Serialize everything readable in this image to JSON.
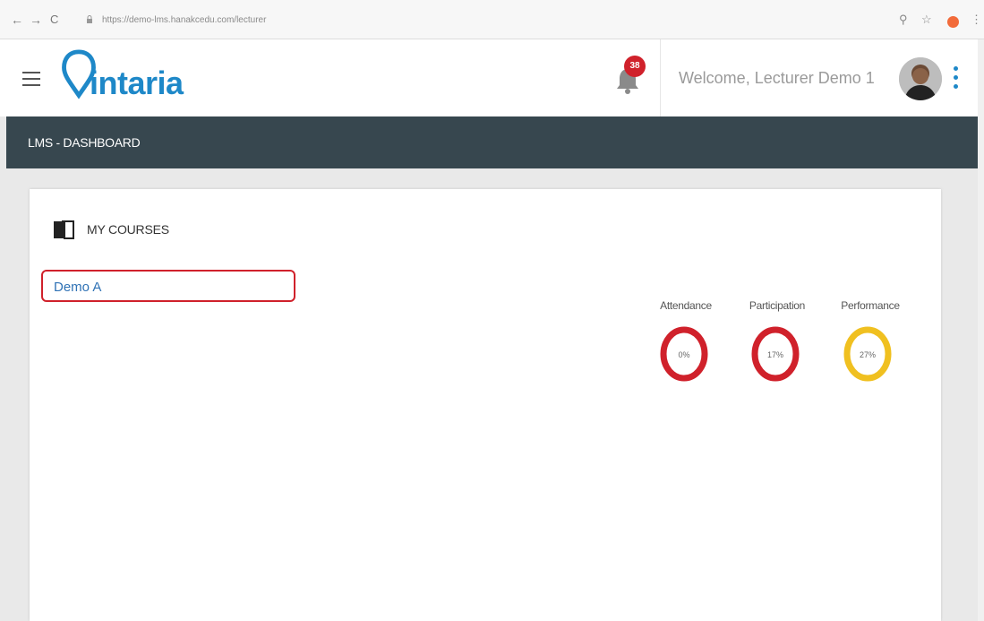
{
  "browser": {
    "url": "https://demo-lms.hanakcedu.com/lecturer",
    "back_icon": "arrow-left-icon",
    "forward_icon": "arrow-right-icon",
    "reload_icon": "reload-icon"
  },
  "header": {
    "brand": "intaria",
    "notification_count": "38",
    "welcome_text": "Welcome, Lecturer Demo 1"
  },
  "title_bar": {
    "title": "LMS - DASHBOARD"
  },
  "courses": {
    "heading": "MY COURSES",
    "items": [
      {
        "label": "Demo A"
      }
    ]
  },
  "metrics": [
    {
      "label": "Attendance",
      "value_text": "0%",
      "value": 0,
      "color": "#d0212b"
    },
    {
      "label": "Participation",
      "value_text": "17%",
      "value": 17,
      "color": "#d0212b"
    },
    {
      "label": "Performance",
      "value_text": "27%",
      "value": 27,
      "color": "#f0c020"
    }
  ],
  "colors": {
    "brand": "#1e88c8",
    "title_bar": "#37474f",
    "alert": "#d0212b"
  }
}
